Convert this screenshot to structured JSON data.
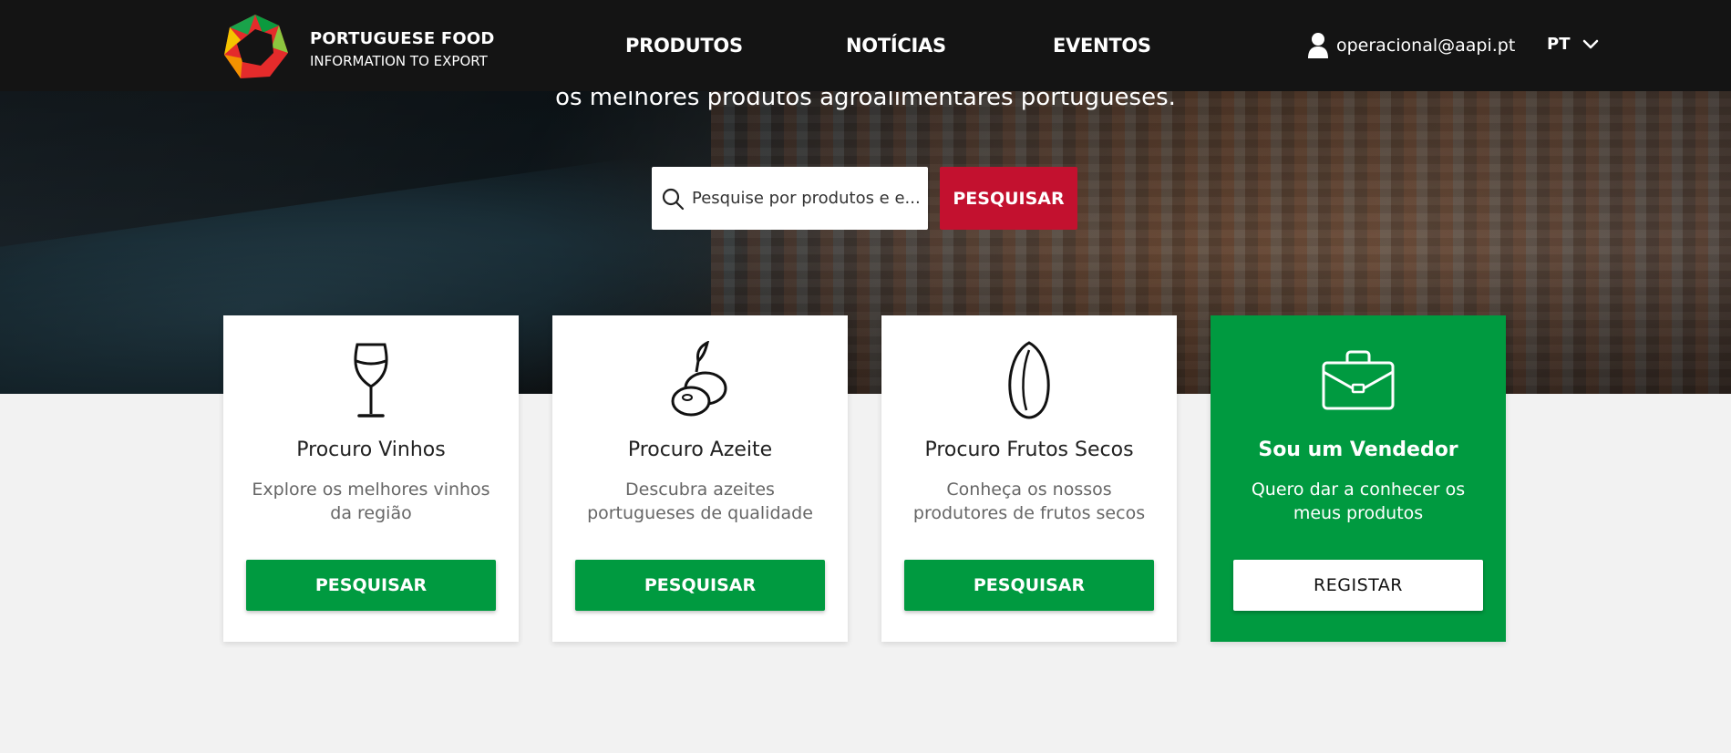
{
  "nav": {
    "logo_title": "PORTUGUESE FOOD",
    "logo_subtitle": "INFORMATION TO EXPORT",
    "links": [
      "PRODUTOS",
      "NOTÍCIAS",
      "EVENTOS"
    ],
    "user_email": "operacional@aapi.pt",
    "language": "PT"
  },
  "hero": {
    "subtitle": "os melhores produtos agroalimentares portugueses."
  },
  "search": {
    "placeholder": "Pesquise por produtos e e...",
    "button_label": "PESQUISAR"
  },
  "cards": [
    {
      "icon": "wine-glass-icon",
      "title": "Procuro Vinhos",
      "description": "Explore os melhores vinhos da região",
      "button": "PESQUISAR"
    },
    {
      "icon": "olives-icon",
      "title": "Procuro Azeite",
      "description": "Descubra azeites portugueses de qualidade",
      "button": "PESQUISAR"
    },
    {
      "icon": "almond-icon",
      "title": "Procuro Frutos Secos",
      "description": "Conheça os nossos produtores de frutos secos",
      "button": "PESQUISAR"
    },
    {
      "icon": "briefcase-icon",
      "title": "Sou um Vendedor",
      "description": "Quero dar a conhecer os meus produtos",
      "button": "REGISTAR"
    }
  ],
  "colors": {
    "nav_background": "#141414",
    "accent_red": "#c3112f",
    "accent_green": "#009a40",
    "page_background": "#f2f2f2"
  }
}
